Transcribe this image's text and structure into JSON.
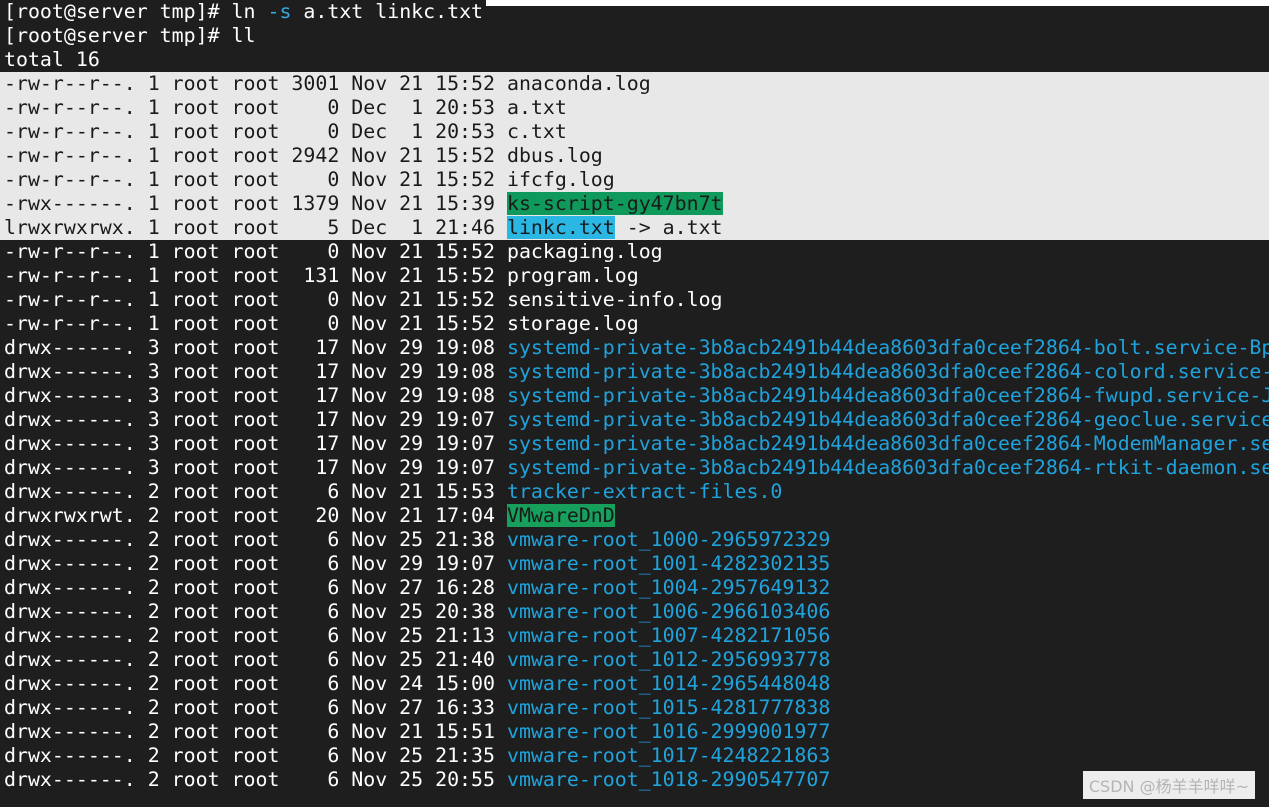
{
  "terminal": {
    "prompt1": "[root@server tmp]# ",
    "cmd1_a": "ln ",
    "cmd1_flag": "-s",
    "cmd1_b": " a.txt linkc.txt",
    "prompt2": "[root@server tmp]# ",
    "cmd2": "ll",
    "total": "total 16"
  },
  "listing": [
    {
      "meta": "-rw-r--r--. 1 root root 3001 Nov 21 15:52 ",
      "name": "anaconda.log",
      "kind": "file",
      "selected": true
    },
    {
      "meta": "-rw-r--r--. 1 root root    0 Dec  1 20:53 ",
      "name": "a.txt",
      "kind": "file",
      "selected": true
    },
    {
      "meta": "-rw-r--r--. 1 root root    0 Dec  1 20:53 ",
      "name": "c.txt",
      "kind": "file",
      "selected": true
    },
    {
      "meta": "-rw-r--r--. 1 root root 2942 Nov 21 15:52 ",
      "name": "dbus.log",
      "kind": "file",
      "selected": true
    },
    {
      "meta": "-rw-r--r--. 1 root root    0 Nov 21 15:52 ",
      "name": "ifcfg.log",
      "kind": "file",
      "selected": true
    },
    {
      "meta": "-rwx------. 1 root root 1379 Nov 21 15:39 ",
      "name": "ks-script-gy47bn7t",
      "kind": "exec",
      "selected": true
    },
    {
      "meta": "lrwxrwxrwx. 1 root root    5 Dec  1 21:46 ",
      "name": "linkc.txt",
      "kind": "link",
      "target": " -> a.txt",
      "selected": true
    },
    {
      "meta": "-rw-r--r--. 1 root root    0 Nov 21 15:52 ",
      "name": "packaging.log",
      "kind": "file"
    },
    {
      "meta": "-rw-r--r--. 1 root root  131 Nov 21 15:52 ",
      "name": "program.log",
      "kind": "file"
    },
    {
      "meta": "-rw-r--r--. 1 root root    0 Nov 21 15:52 ",
      "name": "sensitive-info.log",
      "kind": "file"
    },
    {
      "meta": "-rw-r--r--. 1 root root    0 Nov 21 15:52 ",
      "name": "storage.log",
      "kind": "file"
    },
    {
      "meta": "drwx------. 3 root root   17 Nov 29 19:08 ",
      "name": "systemd-private-3b8acb2491b44dea8603dfa0ceef2864-bolt.service-Bp",
      "kind": "dir"
    },
    {
      "meta": "drwx------. 3 root root   17 Nov 29 19:08 ",
      "name": "systemd-private-3b8acb2491b44dea8603dfa0ceef2864-colord.service-",
      "kind": "dir"
    },
    {
      "meta": "drwx------. 3 root root   17 Nov 29 19:08 ",
      "name": "systemd-private-3b8acb2491b44dea8603dfa0ceef2864-fwupd.service-J",
      "kind": "dir"
    },
    {
      "meta": "drwx------. 3 root root   17 Nov 29 19:07 ",
      "name": "systemd-private-3b8acb2491b44dea8603dfa0ceef2864-geoclue.service",
      "kind": "dir"
    },
    {
      "meta": "drwx------. 3 root root   17 Nov 29 19:07 ",
      "name": "systemd-private-3b8acb2491b44dea8603dfa0ceef2864-ModemManager.se",
      "kind": "dir"
    },
    {
      "meta": "drwx------. 3 root root   17 Nov 29 19:07 ",
      "name": "systemd-private-3b8acb2491b44dea8603dfa0ceef2864-rtkit-daemon.se",
      "kind": "dir"
    },
    {
      "meta": "drwx------. 2 root root    6 Nov 21 15:53 ",
      "name": "tracker-extract-files.0",
      "kind": "dir"
    },
    {
      "meta": "drwxrwxrwt. 2 root root   20 Nov 21 17:04 ",
      "name": "VMwareDnD",
      "kind": "sticky"
    },
    {
      "meta": "drwx------. 2 root root    6 Nov 25 21:38 ",
      "name": "vmware-root_1000-2965972329",
      "kind": "dir"
    },
    {
      "meta": "drwx------. 2 root root    6 Nov 29 19:07 ",
      "name": "vmware-root_1001-4282302135",
      "kind": "dir"
    },
    {
      "meta": "drwx------. 2 root root    6 Nov 27 16:28 ",
      "name": "vmware-root_1004-2957649132",
      "kind": "dir"
    },
    {
      "meta": "drwx------. 2 root root    6 Nov 25 20:38 ",
      "name": "vmware-root_1006-2966103406",
      "kind": "dir"
    },
    {
      "meta": "drwx------. 2 root root    6 Nov 25 21:13 ",
      "name": "vmware-root_1007-4282171056",
      "kind": "dir"
    },
    {
      "meta": "drwx------. 2 root root    6 Nov 25 21:40 ",
      "name": "vmware-root_1012-2956993778",
      "kind": "dir"
    },
    {
      "meta": "drwx------. 2 root root    6 Nov 24 15:00 ",
      "name": "vmware-root_1014-2965448048",
      "kind": "dir"
    },
    {
      "meta": "drwx------. 2 root root    6 Nov 27 16:33 ",
      "name": "vmware-root_1015-4281777838",
      "kind": "dir"
    },
    {
      "meta": "drwx------. 2 root root    6 Nov 21 15:51 ",
      "name": "vmware-root_1016-2999001977",
      "kind": "dir"
    },
    {
      "meta": "drwx------. 2 root root    6 Nov 25 21:35 ",
      "name": "vmware-root_1017-4248221863",
      "kind": "dir"
    },
    {
      "meta": "drwx------. 2 root root    6 Nov 25 20:55 ",
      "name": "vmware-root_1018-2990547707",
      "kind": "dir"
    }
  ],
  "watermark": "CSDN @杨羊羊咩咩~",
  "colors": {
    "background": "#1e1e1e",
    "selection": "#e8e8e8",
    "directory": "#1fa3dd",
    "executable_bg": "#0f9a5b",
    "symlink_bg": "#2bb7e3",
    "sticky_bg": "#16a05c"
  }
}
